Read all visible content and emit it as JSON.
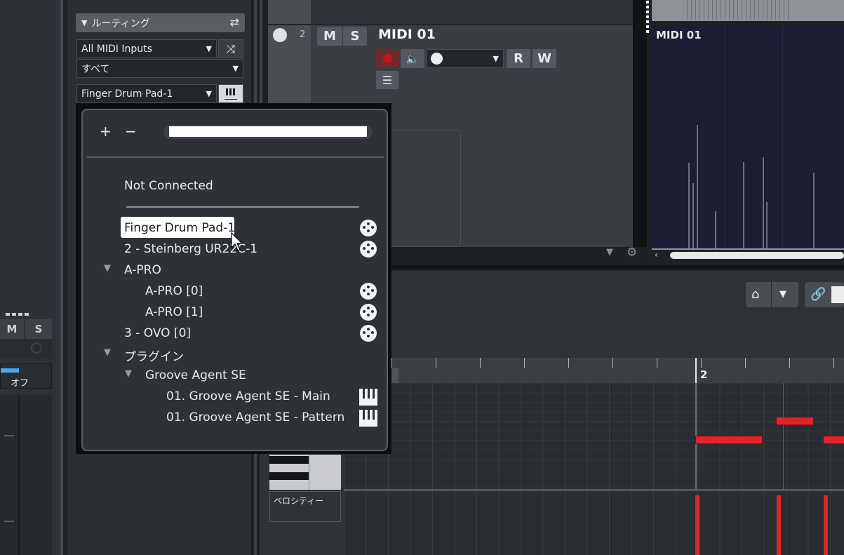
{
  "inspector": {
    "section_title": "ルーティング",
    "input_dropdown": "All MIDI Inputs",
    "channel_dropdown": "すべて",
    "output_dropdown": "Finger Drum Pad-1"
  },
  "left_mixer": {
    "mute": "M",
    "solo": "S",
    "off_label": "オフ"
  },
  "track": {
    "number": "2",
    "mute": "M",
    "solo": "S",
    "name": "MIDI 01",
    "read": "R",
    "write": "W"
  },
  "event_display": {
    "title": "MIDI 01"
  },
  "popup": {
    "add": "+",
    "remove": "−",
    "search_value": "",
    "items": [
      {
        "label": "Not Connected",
        "icon": "none"
      },
      {
        "label": "Finger Drum Pad-1",
        "icon": "midi-port-icon",
        "selected": true
      },
      {
        "label": "2 - Steinberg UR22C-1",
        "icon": "midi-port-icon"
      },
      {
        "label": "A-PRO",
        "icon": "none",
        "group": true
      },
      {
        "label": "A-PRO [0]",
        "icon": "midi-port-icon"
      },
      {
        "label": "A-PRO [1]",
        "icon": "midi-port-icon"
      },
      {
        "label": "3 - OVO [0]",
        "icon": "midi-port-icon"
      },
      {
        "label": "プラグイン",
        "icon": "none",
        "group": true
      },
      {
        "label": "Groove Agent SE",
        "icon": "none",
        "group": true
      },
      {
        "label": "01. Groove Agent SE - Main",
        "icon": "keyboard-icon"
      },
      {
        "label": "01. Groove Agent SE - Pattern",
        "icon": "keyboard-icon"
      }
    ]
  },
  "editor": {
    "ruler_bar": "2",
    "velocity_label": "ベロシティー"
  },
  "colors": {
    "accent_blue": "#4fa6e8",
    "note_red": "#e1242a",
    "record_red": "#c8141c"
  }
}
